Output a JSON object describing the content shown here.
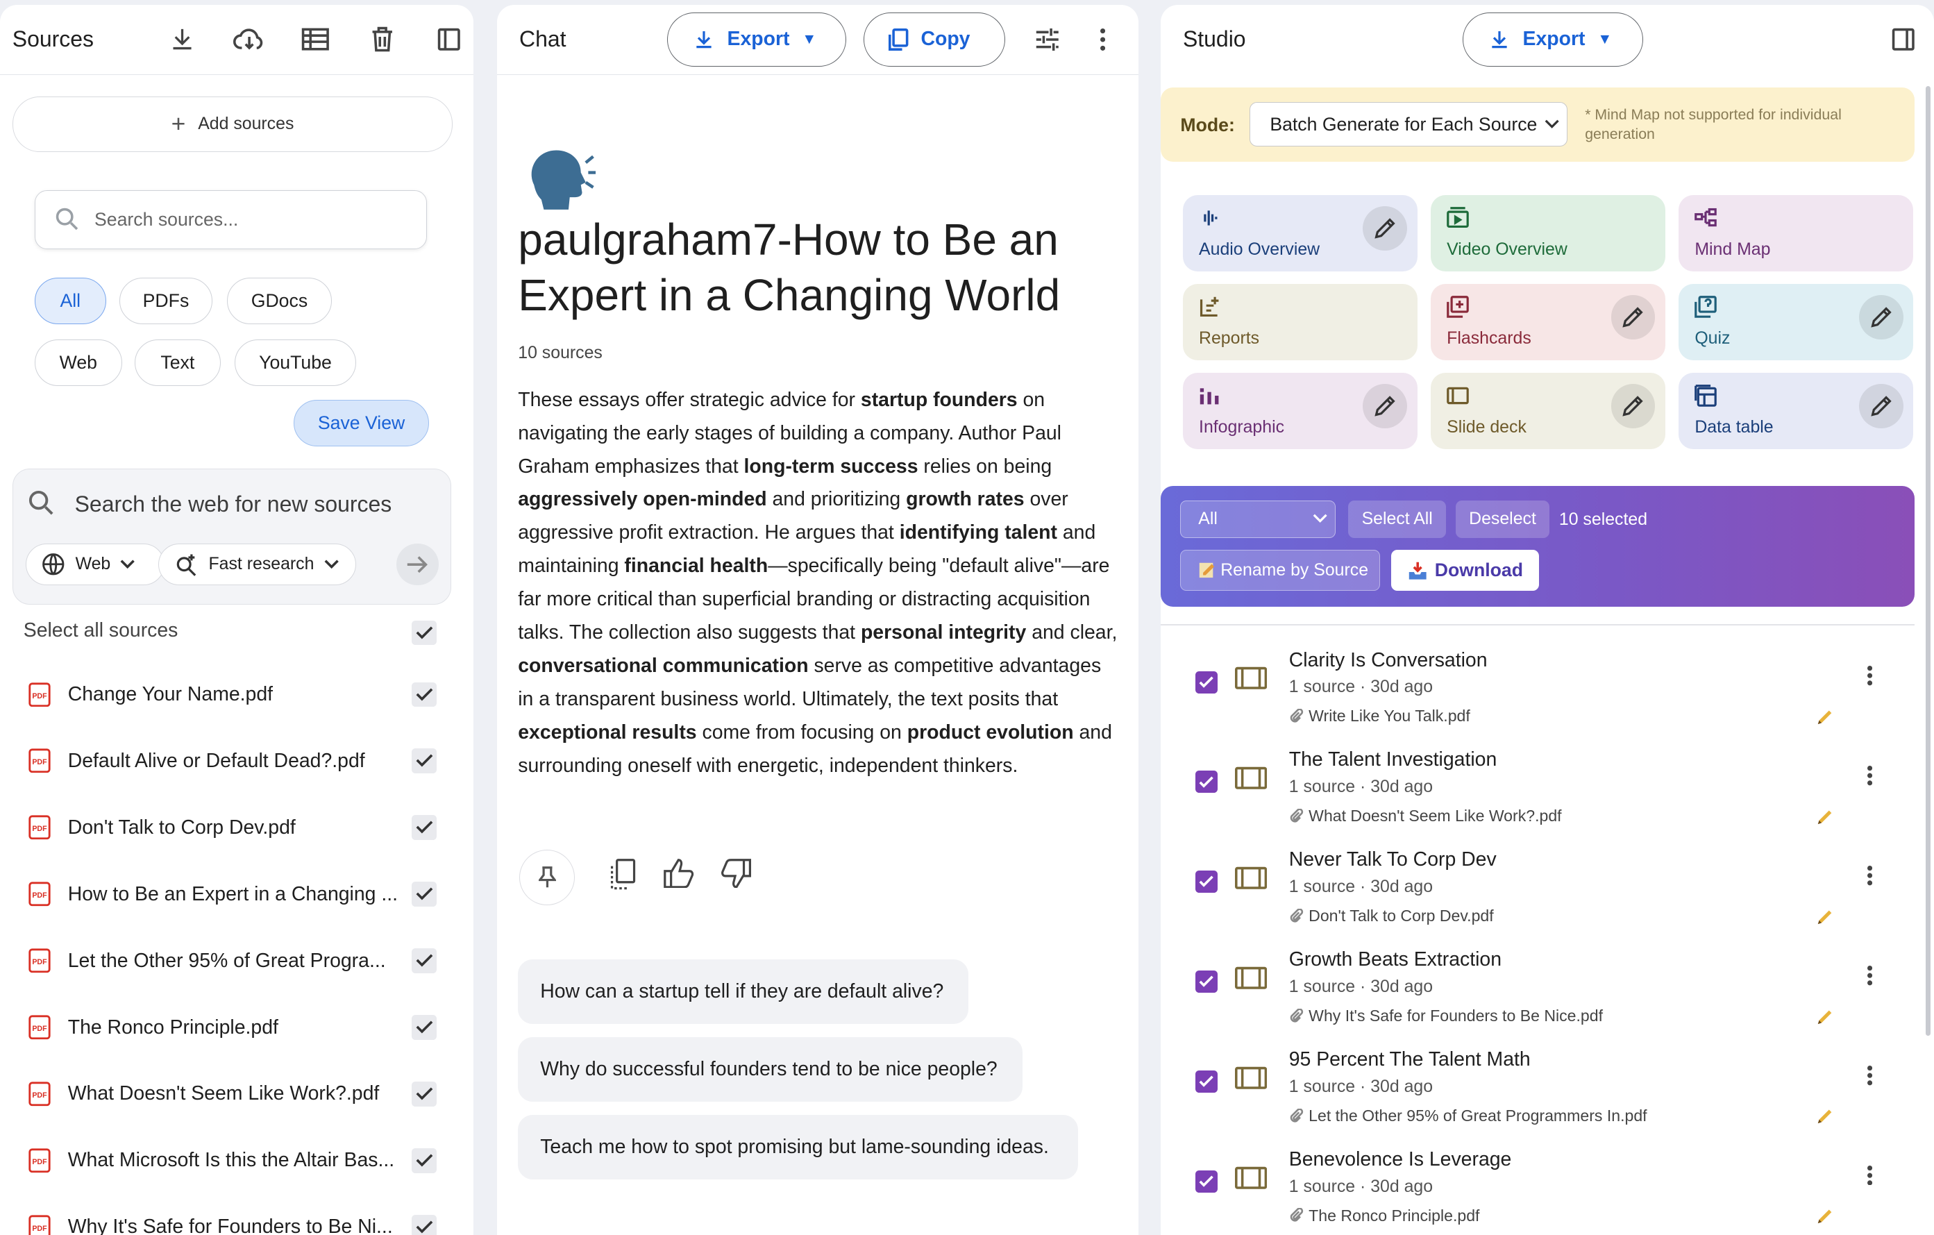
{
  "colors": {
    "accent": "#1a62d6",
    "purple": "#7b3fb5",
    "mode_bg": "#fcf1cd",
    "pdf_red": "#d93025"
  },
  "sources": {
    "title": "Sources",
    "add_label": "Add sources",
    "search_placeholder": "Search sources...",
    "filters": [
      "All",
      "PDFs",
      "GDocs",
      "Web",
      "Text",
      "YouTube"
    ],
    "save_view": "Save View",
    "web_search_placeholder": "Search the web for new sources",
    "web_label": "Web",
    "research_label": "Fast research",
    "select_all": "Select all sources",
    "items": [
      "Change Your Name.pdf",
      "Default Alive or Default Dead?.pdf",
      "Don't Talk to Corp Dev.pdf",
      "How to Be an Expert in a Changing ...",
      "Let the Other 95% of Great Progra...",
      "The Ronco Principle.pdf",
      "What Doesn't Seem Like Work?.pdf",
      "What Microsoft Is this the Altair Bas...",
      "Why It's Safe for Founders to Be Ni..."
    ]
  },
  "chat": {
    "title": "Chat",
    "export": "Export",
    "copy": "Copy",
    "notebook_title": "paulgraham7-How to Be an Expert in a Changing World",
    "source_count": "10 sources",
    "suggestions": [
      "How can a startup tell if they are default alive?",
      "Why do successful founders tend to be nice people?",
      "Teach me how to spot promising but lame-sounding ideas."
    ]
  },
  "studio": {
    "title": "Studio",
    "export": "Export",
    "mode_label": "Mode:",
    "mode_value": "Batch Generate for Each Source",
    "mode_note": "* Mind Map not supported for individual generation",
    "tiles": [
      {
        "label": "Audio Overview",
        "color": "#1b3f7a",
        "bg": "#e6e9f6"
      },
      {
        "label": "Video Overview",
        "color": "#1e6b3a",
        "bg": "#dff0e3"
      },
      {
        "label": "Mind Map",
        "color": "#6a2f73",
        "bg": "#f1e6f1"
      },
      {
        "label": "Reports",
        "color": "#6e5a2a",
        "bg": "#f0efe4"
      },
      {
        "label": "Flashcards",
        "color": "#8a2a3a",
        "bg": "#f7e6e6"
      },
      {
        "label": "Quiz",
        "color": "#1e5f7a",
        "bg": "#dfeff4"
      },
      {
        "label": "Infographic",
        "color": "#6a2f73",
        "bg": "#f0e6f1"
      },
      {
        "label": "Slide deck",
        "color": "#6e5a2a",
        "bg": "#f0efe4"
      },
      {
        "label": "Data table",
        "color": "#1b3f7a",
        "bg": "#e6e9f6"
      }
    ],
    "batch": {
      "filter": "All",
      "select_all": "Select All",
      "deselect": "Deselect",
      "count": "10 selected",
      "rename": "Rename by Source",
      "download": "Download"
    },
    "notes": [
      {
        "title": "Clarity Is Conversation",
        "meta": "1 source · 30d ago",
        "file": "Write Like You Talk.pdf"
      },
      {
        "title": "The Talent Investigation",
        "meta": "1 source · 30d ago",
        "file": "What Doesn't Seem Like Work?.pdf"
      },
      {
        "title": "Never Talk To Corp Dev",
        "meta": "1 source · 30d ago",
        "file": "Don't Talk to Corp Dev.pdf"
      },
      {
        "title": "Growth Beats Extraction",
        "meta": "1 source · 30d ago",
        "file": "Why It's Safe for Founders to Be Nice.pdf"
      },
      {
        "title": "95 Percent The Talent Math",
        "meta": "1 source · 30d ago",
        "file": "Let the Other 95% of Great Programmers In.pdf"
      },
      {
        "title": "Benevolence Is Leverage",
        "meta": "1 source · 30d ago",
        "file": "The Ronco Principle.pdf"
      }
    ]
  }
}
